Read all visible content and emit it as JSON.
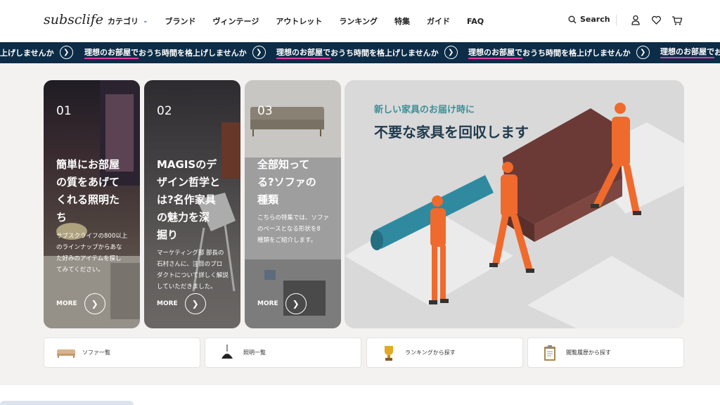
{
  "header": {
    "logo": "subsclife",
    "nav": [
      {
        "label": "カテゴリ",
        "has_dropdown": true
      },
      {
        "label": "ブランド"
      },
      {
        "label": "ヴィンテージ"
      },
      {
        "label": "アウトレット"
      },
      {
        "label": "ランキング"
      },
      {
        "label": "特集"
      },
      {
        "label": "ガイド"
      },
      {
        "label": "FAQ"
      }
    ],
    "search_label": "Search",
    "icons": [
      "search-icon",
      "user-icon",
      "heart-icon",
      "cart-icon"
    ]
  },
  "marquee": {
    "fragment": "上げしませんか",
    "highlight": "理想のお部屋で",
    "rest": "おうち時間を格上げしませんか"
  },
  "cards": [
    {
      "num": "01",
      "title": [
        "簡単にお部屋",
        "の質をあげて",
        "くれる照明た",
        "ち"
      ],
      "desc": [
        "サブスクライフの800以上",
        "のラインナップからあな",
        "た好みのアイテムを探し",
        "てみてください。"
      ],
      "more": "MORE"
    },
    {
      "num": "02",
      "title": [
        "MAGISのデ",
        "ザイン哲学と",
        "は?名作家具",
        "の魅力を深",
        "掘り"
      ],
      "desc": [
        "マーケティング部 部長の",
        "石村さんに、注目のプロ",
        "ダクトについて詳しく解説",
        "していただきました。"
      ],
      "more": "MORE"
    },
    {
      "num": "03",
      "title": [
        "全部知って",
        "る?ソファの",
        "種類"
      ],
      "desc": [
        "こちらの特集では、ソファ",
        "のベースとなる形状を8",
        "種類をご紹介します。"
      ],
      "more": "MORE"
    }
  ],
  "hero": {
    "subtitle": "新しい家具のお届け時に",
    "title": "不要な家具を回収します"
  },
  "categories": [
    {
      "label": "ソファ一覧",
      "icon": "sofa-icon"
    },
    {
      "label": "照明一覧",
      "icon": "lamp-icon"
    },
    {
      "label": "ランキングから探す",
      "icon": "trophy-icon"
    },
    {
      "label": "閲覧履歴から探す",
      "icon": "clipboard-icon"
    }
  ],
  "colors": {
    "marquee_bg": "#0d2c47",
    "marquee_highlight": "#e23aa3",
    "hero_subtitle": "#3d8f97",
    "hero_title": "#1f3a4d",
    "worker_orange": "#ef6a2d",
    "sofa_brown": "#6b3a36"
  }
}
